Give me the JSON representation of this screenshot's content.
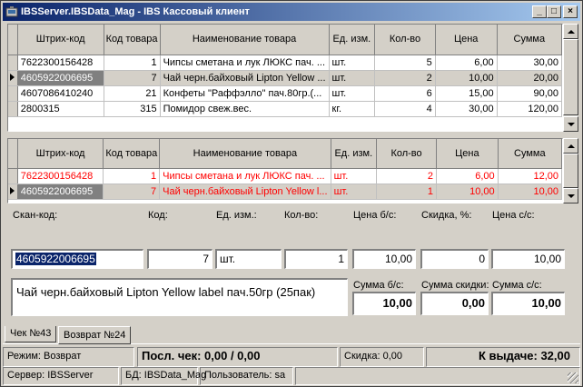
{
  "window": {
    "title": "IBSServer.IBSData_Mag - IBS Кассовый клиент",
    "minimize": "_",
    "maximize": "□",
    "close": "×"
  },
  "columns": [
    "Штрих-код",
    "Код товара",
    "Наименование товара",
    "Ед. изм.",
    "Кол-во",
    "Цена",
    "Сумма"
  ],
  "receipt_grid": {
    "rows": [
      {
        "barcode": "7622300156428",
        "code": "1",
        "name": "Чипсы сметана и лук ЛЮКС пач. ...",
        "unit": "шт.",
        "qty": "5",
        "price": "6,00",
        "sum": "30,00"
      },
      {
        "barcode": "4605922006695",
        "code": "7",
        "name": "Чай черн.байховый Lipton Yellow ...",
        "unit": "шт.",
        "qty": "2",
        "price": "10,00",
        "sum": "20,00"
      },
      {
        "barcode": "4607086410240",
        "code": "21",
        "name": "Конфеты \"Раффэлло\" пач.80гр.(...",
        "unit": "шт.",
        "qty": "6",
        "price": "15,00",
        "sum": "90,00"
      },
      {
        "barcode": "2800315",
        "code": "315",
        "name": "Помидор свеж.вес.",
        "unit": "кг.",
        "qty": "4",
        "price": "30,00",
        "sum": "120,00"
      }
    ]
  },
  "return_grid": {
    "rows": [
      {
        "barcode": "7622300156428",
        "code": "1",
        "name": "Чипсы сметана и лук ЛЮКС пач. ...",
        "unit": "шт.",
        "qty": "2",
        "price": "6,00",
        "sum": "12,00"
      },
      {
        "barcode": "4605922006695",
        "code": "7",
        "name": "Чай черн.байховый Lipton Yellow l...",
        "unit": "шт.",
        "qty": "1",
        "price": "10,00",
        "sum": "10,00"
      }
    ]
  },
  "form": {
    "scan_label": "Скан-код:",
    "scan_value": "4605922006695",
    "code_label": "Код:",
    "code_value": "7",
    "unit_label": "Ед. изм.:",
    "unit_value": "шт.",
    "qty_label": "Кол-во:",
    "qty_value": "1",
    "price_nodisc_label": "Цена б/с:",
    "price_nodisc_value": "10,00",
    "discount_label": "Скидка, %:",
    "discount_value": "0",
    "price_disc_label": "Цена с/с:",
    "price_disc_value": "10,00",
    "item_name": "Чай черн.байховый Lipton Yellow label пач.50гр (25пак)",
    "sum_nodisc_label": "Сумма б/с:",
    "sum_nodisc_value": "10,00",
    "sum_discount_label": "Сумма скидки:",
    "sum_discount_value": "0,00",
    "sum_disc_label": "Сумма с/с:",
    "sum_disc_value": "10,00"
  },
  "tabs": [
    {
      "label": "Чек №43"
    },
    {
      "label": "Возврат №24"
    }
  ],
  "status1": {
    "mode": "Режим: Возврат",
    "last_check": "Посл. чек: 0,00 / 0,00",
    "discount": "Скидка: 0,00",
    "payout": "К выдаче:  32,00"
  },
  "status2": {
    "server": "Сервер: IBSServer",
    "db": "БД: IBSData_Mag",
    "user": "Пользователь: sa"
  }
}
